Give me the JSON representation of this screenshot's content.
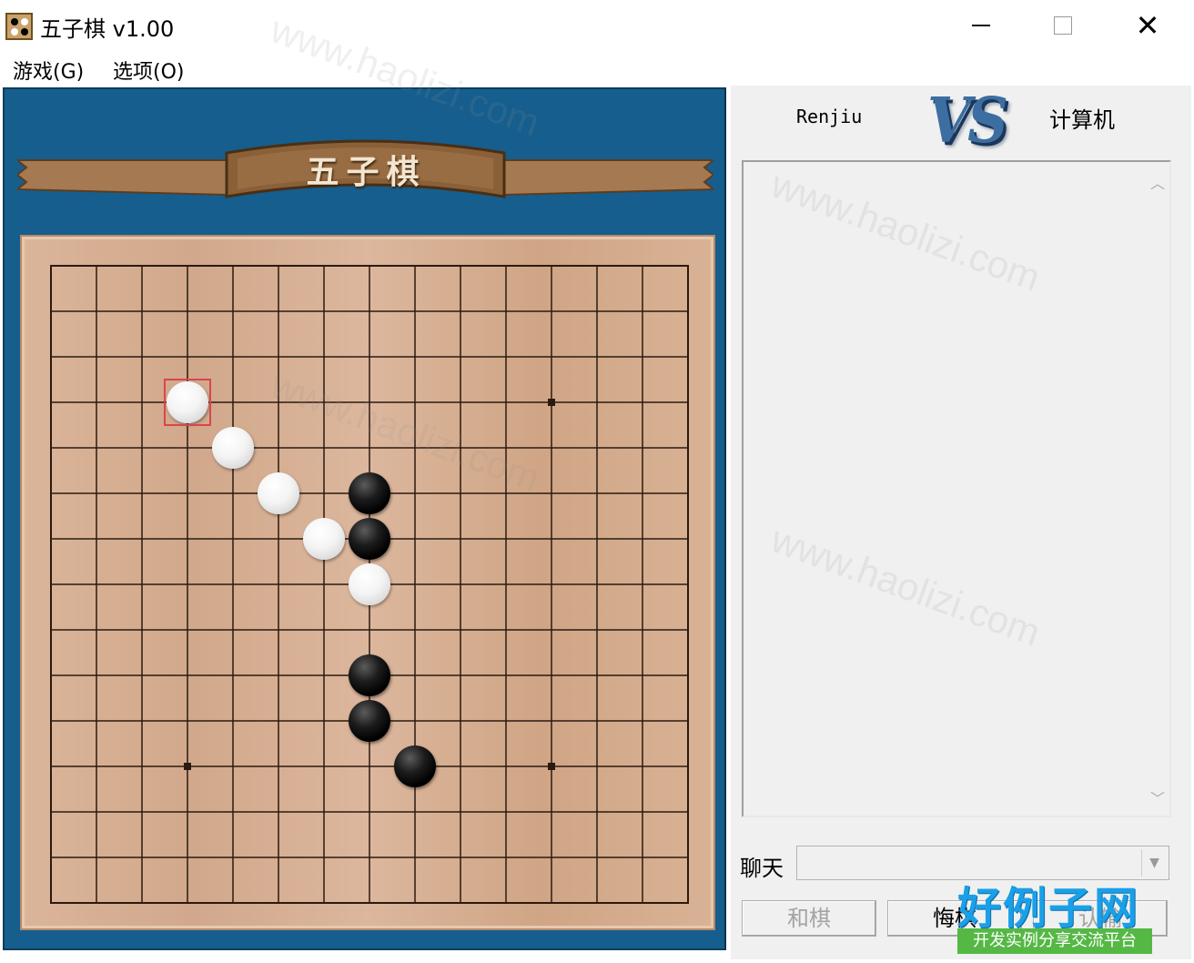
{
  "window": {
    "title": "五子棋 v1.00",
    "close_glyph": "✕"
  },
  "menu": [
    "游戏(G)",
    "选项(O)"
  ],
  "banner": {
    "title": "五子棋"
  },
  "board": {
    "size": 15,
    "star_points": [
      [
        11,
        3
      ],
      [
        3,
        11
      ],
      [
        11,
        11
      ]
    ],
    "stones": [
      {
        "color": "white",
        "col": 3,
        "row": 3
      },
      {
        "color": "white",
        "col": 4,
        "row": 4
      },
      {
        "color": "white",
        "col": 5,
        "row": 5
      },
      {
        "color": "black",
        "col": 7,
        "row": 5
      },
      {
        "color": "white",
        "col": 6,
        "row": 6
      },
      {
        "color": "black",
        "col": 7,
        "row": 6
      },
      {
        "color": "white",
        "col": 7,
        "row": 7
      },
      {
        "color": "black",
        "col": 7,
        "row": 9
      },
      {
        "color": "black",
        "col": 7,
        "row": 10
      },
      {
        "color": "black",
        "col": 8,
        "row": 11
      }
    ],
    "last_move": {
      "col": 3,
      "row": 3
    }
  },
  "players": {
    "player": "Renjiu",
    "vs": "VS",
    "opponent": "计算机"
  },
  "chat": {
    "label": "聊天",
    "value": ""
  },
  "buttons": {
    "draw": "和棋",
    "undo": "悔棋",
    "resign": "认输"
  },
  "watermark": {
    "main": "好例子网",
    "sub": "开发实例分享交流平台",
    "faint": "www.haolizi.com"
  },
  "colors": {
    "board_panel": "#165e8d",
    "board_wood": "#d6ad90",
    "grid_line": "#2b1a10",
    "last_move_marker": "#d9454e",
    "vs_logo": "#3c6ea2"
  }
}
